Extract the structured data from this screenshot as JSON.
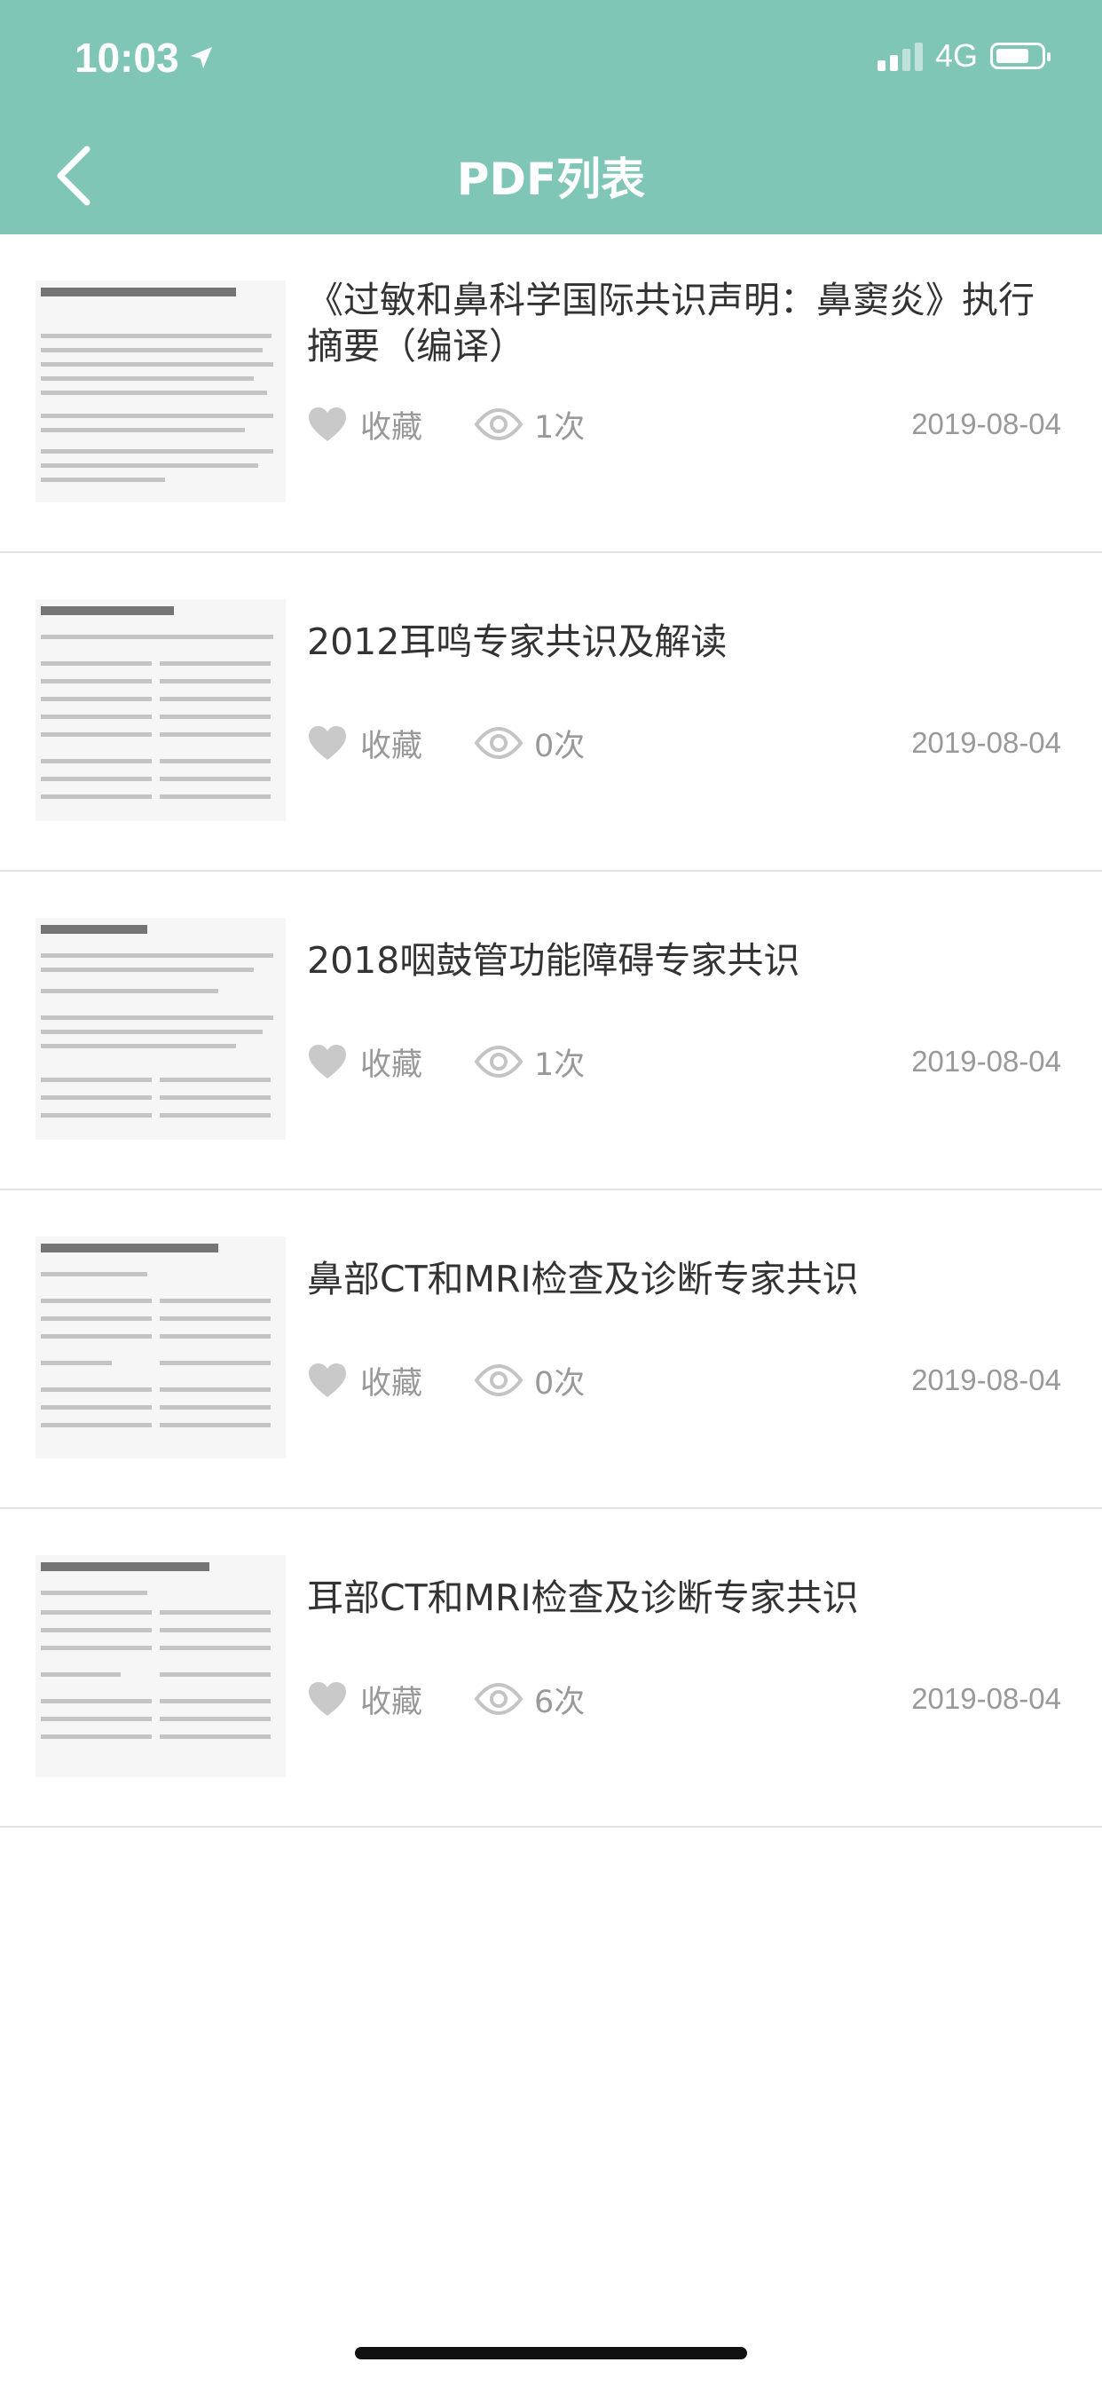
{
  "status_bar": {
    "time": "10:03",
    "network": "4G"
  },
  "header": {
    "title": "PDF列表"
  },
  "items": [
    {
      "title": "《过敏和鼻科学国际共识声明：鼻窦炎》执行摘要（编译）",
      "fav_label": "收藏",
      "views": "1次",
      "date": "2019-08-04"
    },
    {
      "title": "2012耳鸣专家共识及解读",
      "fav_label": "收藏",
      "views": "0次",
      "date": "2019-08-04"
    },
    {
      "title": "2018咽鼓管功能障碍专家共识",
      "fav_label": "收藏",
      "views": "1次",
      "date": "2019-08-04"
    },
    {
      "title": "鼻部CT和MRI检查及诊断专家共识",
      "fav_label": "收藏",
      "views": "0次",
      "date": "2019-08-04"
    },
    {
      "title": "耳部CT和MRI检查及诊断专家共识",
      "fav_label": "收藏",
      "views": "6次",
      "date": "2019-08-04"
    }
  ],
  "colors": {
    "header": "#7fc6b6",
    "meta_text": "#999999",
    "divider": "#e4e4e4"
  }
}
